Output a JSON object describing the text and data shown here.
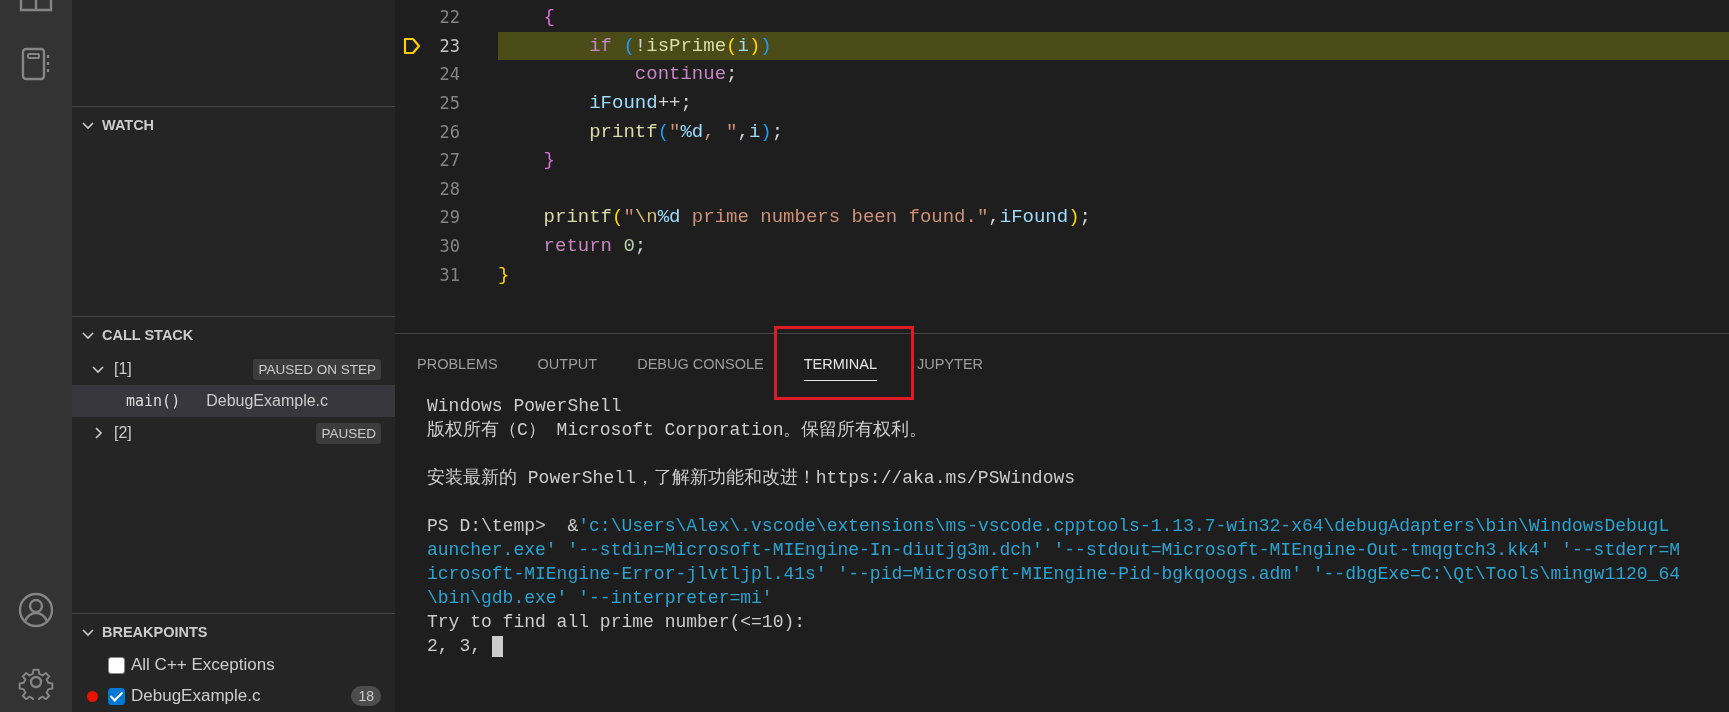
{
  "activity_bar": {
    "items": [
      {
        "kind": "panel"
      },
      {
        "kind": "notebook"
      }
    ],
    "bottom": [
      {
        "kind": "account"
      },
      {
        "kind": "settings"
      }
    ]
  },
  "sidebar": {
    "watch": {
      "title": "WATCH",
      "expanded": true
    },
    "call_stack": {
      "title": "CALL STACK",
      "expanded": true,
      "threads": [
        {
          "label": "[1]",
          "badge": "PAUSED ON STEP",
          "expanded": true,
          "frames": [
            {
              "name": "main()",
              "file": "DebugExample.c",
              "selected": true
            }
          ]
        },
        {
          "label": "[2]",
          "badge": "PAUSED",
          "expanded": false
        }
      ]
    },
    "breakpoints": {
      "title": "BREAKPOINTS",
      "expanded": true,
      "items": [
        {
          "label": "All C++ Exceptions",
          "checked": false,
          "marker": false
        },
        {
          "label": "DebugExample.c",
          "checked": true,
          "marker": true,
          "count": "18"
        }
      ]
    }
  },
  "editor": {
    "lines": [
      {
        "number": "22",
        "current": false,
        "tokens": [
          {
            "kind": "bracket2",
            "text": "    {"
          }
        ]
      },
      {
        "number": "23",
        "current": true,
        "tokens": [
          {
            "kind": "keyword",
            "text": "        if "
          },
          {
            "kind": "bracket3",
            "text": "("
          },
          {
            "kind": "plain",
            "text": "!"
          },
          {
            "kind": "function",
            "text": "isPrime"
          },
          {
            "kind": "bracket1",
            "text": "("
          },
          {
            "kind": "variable",
            "text": "i"
          },
          {
            "kind": "bracket1",
            "text": ")"
          },
          {
            "kind": "bracket3",
            "text": ")"
          }
        ]
      },
      {
        "number": "24",
        "current": false,
        "tokens": [
          {
            "kind": "keyword",
            "text": "            continue"
          },
          {
            "kind": "plain",
            "text": ";"
          }
        ]
      },
      {
        "number": "25",
        "current": false,
        "tokens": [
          {
            "kind": "variable",
            "text": "        iFound"
          },
          {
            "kind": "plain",
            "text": "++;"
          }
        ]
      },
      {
        "number": "26",
        "current": false,
        "tokens": [
          {
            "kind": "function",
            "text": "        printf"
          },
          {
            "kind": "bracket3",
            "text": "("
          },
          {
            "kind": "string",
            "text": "\""
          },
          {
            "kind": "format",
            "text": "%d"
          },
          {
            "kind": "string",
            "text": ", \""
          },
          {
            "kind": "plain",
            "text": ","
          },
          {
            "kind": "variable",
            "text": "i"
          },
          {
            "kind": "bracket3",
            "text": ")"
          },
          {
            "kind": "plain",
            "text": ";"
          }
        ]
      },
      {
        "number": "27",
        "current": false,
        "tokens": [
          {
            "kind": "bracket2",
            "text": "    }"
          }
        ]
      },
      {
        "number": "28",
        "current": false
      },
      {
        "number": "29",
        "current": false,
        "tokens": [
          {
            "kind": "function",
            "text": "    printf"
          },
          {
            "kind": "bracket1",
            "text": "("
          },
          {
            "kind": "string",
            "text": "\""
          },
          {
            "kind": "escape",
            "text": "\\n"
          },
          {
            "kind": "format",
            "text": "%d"
          },
          {
            "kind": "string",
            "text": " prime numbers been found.\""
          },
          {
            "kind": "plain",
            "text": ","
          },
          {
            "kind": "variable",
            "text": "iFound"
          },
          {
            "kind": "bracket1",
            "text": ")"
          },
          {
            "kind": "plain",
            "text": ";"
          }
        ]
      },
      {
        "number": "30",
        "current": false,
        "tokens": [
          {
            "kind": "keyword",
            "text": "    return "
          },
          {
            "kind": "number",
            "text": "0"
          },
          {
            "kind": "plain",
            "text": ";"
          }
        ]
      },
      {
        "number": "31",
        "current": false,
        "tokens": [
          {
            "kind": "bracket1",
            "text": "}"
          }
        ]
      }
    ]
  },
  "panel": {
    "tabs": [
      {
        "label": "PROBLEMS",
        "selected": false
      },
      {
        "label": "OUTPUT",
        "selected": false
      },
      {
        "label": "DEBUG CONSOLE",
        "selected": false
      },
      {
        "label": "TERMINAL",
        "selected": true,
        "highlighted": true
      },
      {
        "label": "JUPYTER",
        "selected": false
      }
    ],
    "terminal": [
      {
        "kind": "plain",
        "text": "Windows PowerShell"
      },
      {
        "kind": "plain",
        "text": "版权所有（C） Microsoft Corporation。保留所有权利。"
      },
      {
        "kind": "blank"
      },
      {
        "kind": "plain",
        "text": "安装最新的 PowerShell，了解新功能和改进！https://aka.ms/PSWindows"
      },
      {
        "kind": "blank"
      },
      {
        "kind": "prompt",
        "prompt": "PS D:\\temp>  &",
        "text": "'c:\\Users\\Alex\\.vscode\\extensions\\ms-vscode.cpptools-1.13.7-win32-x64\\debugAdapters\\bin\\WindowsDebugL"
      },
      {
        "kind": "arg",
        "text": "auncher.exe' '--stdin=Microsoft-MIEngine-In-diutjg3m.dch' '--stdout=Microsoft-MIEngine-Out-tmqgtch3.kk4' '--stderr=M"
      },
      {
        "kind": "arg",
        "text": "icrosoft-MIEngine-Error-jlvtljpl.41s' '--pid=Microsoft-MIEngine-Pid-bgkqoogs.adm' '--dbgExe=C:\\Qt\\Tools\\mingw1120_64"
      },
      {
        "kind": "arg",
        "text": "\\bin\\gdb.exe' '--interpreter=mi'"
      },
      {
        "kind": "plain",
        "text": "Try to find all prime number(<=10):"
      },
      {
        "kind": "input",
        "text": "2, 3,",
        "cursor": true
      }
    ]
  }
}
